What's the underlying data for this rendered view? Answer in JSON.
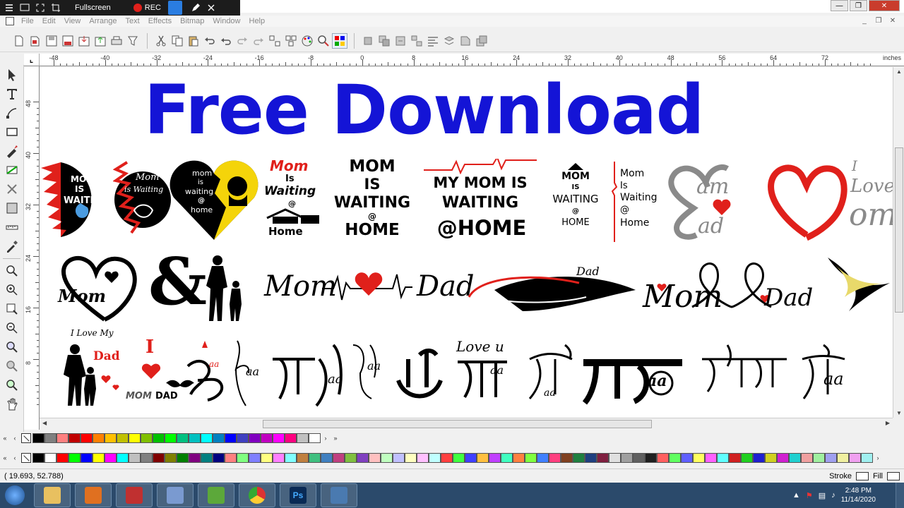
{
  "recorder": {
    "fullscreen_label": "Fullscreen",
    "rec_label": "REC"
  },
  "menu": [
    "File",
    "Edit",
    "View",
    "Arrange",
    "Text",
    "Effects",
    "Bitmap",
    "Window",
    "Help"
  ],
  "ruler": {
    "h_labels": [
      "-48",
      "-40",
      "-32",
      "-24",
      "-16",
      "-8",
      "0",
      "8",
      "16",
      "24",
      "32",
      "40",
      "48",
      "56",
      "64",
      "72"
    ],
    "v_labels": [
      "48",
      "40",
      "32",
      "24",
      "16",
      "8"
    ],
    "unit": "inches"
  },
  "canvas": {
    "headline": "Free Download",
    "row1": {
      "a1": "MOM",
      "a2": "IS",
      "a3": "WAITING",
      "b1": "Mom",
      "b2": "is Waiting",
      "c1": "mom",
      "c2": "is",
      "c3": "waiting",
      "c4": "@",
      "c5": "home",
      "d1": "Mom",
      "d2": "Is",
      "d3": "Waiting",
      "d4": "@",
      "d5": "Home",
      "e1": "MOM",
      "e2": "IS",
      "e3": "WAITING",
      "e4": "@",
      "e5": "HOME",
      "f1": "MY MOM IS",
      "f2": "WAITING",
      "f3": "@HOME",
      "g1": "MOM",
      "g2": "IS",
      "g3": "WAITING",
      "g4": "@",
      "g5": "HOME",
      "h1": "Mom",
      "h2": "Is",
      "h3": "Waiting",
      "h4": "@",
      "h5": "Home",
      "i1": "am",
      "i2": "ad",
      "j1": "I",
      "j2": "Love",
      "j3": "om"
    },
    "row2": {
      "k1": "Mom",
      "l1": "&",
      "m1": "Mom",
      "m2": "Dad",
      "n1": "Mom",
      "n2": "Dad",
      "o1": "Mom",
      "o2": "Dad"
    },
    "row3": {
      "p1": "I Love My",
      "p2": "Dad",
      "q1": "I",
      "q2": "MOM",
      "q3": "DAD",
      "r1": "aa",
      "s1": "aa",
      "t1": "aa",
      "u1": "aa",
      "v1": "Love u",
      "v2": "aa",
      "w1": "aa",
      "x1": "aa",
      "y1": "aa"
    }
  },
  "status": {
    "coords": "( 19.693,    52.788)",
    "stroke_label": "Stroke",
    "fill_label": "Fill"
  },
  "clock": {
    "time": "2:48 PM",
    "date": "11/14/2020"
  },
  "palette_colors_1": [
    "#000000",
    "#808080",
    "#ff8080",
    "#c00000",
    "#ff0000",
    "#ff8000",
    "#ffc000",
    "#c0c000",
    "#ffff00",
    "#80c000",
    "#00c000",
    "#00ff00",
    "#00c080",
    "#00c0c0",
    "#00ffff",
    "#0080c0",
    "#0000ff",
    "#4040c0",
    "#8000c0",
    "#c000c0",
    "#ff00ff",
    "#ff0080",
    "#c0c0c0",
    "#ffffff"
  ],
  "palette_colors_2": [
    "#000000",
    "#ffffff",
    "#ff0000",
    "#00ff00",
    "#0000ff",
    "#ffff00",
    "#ff00ff",
    "#00ffff",
    "#c0c0c0",
    "#808080",
    "#800000",
    "#808000",
    "#008000",
    "#800080",
    "#008080",
    "#000080",
    "#ff8080",
    "#80ff80",
    "#8080ff",
    "#ffff80",
    "#ff80ff",
    "#80ffff",
    "#c08040",
    "#40c080",
    "#4080c0",
    "#c04080",
    "#80c040",
    "#8040c0",
    "#ffc0c0",
    "#c0ffc0",
    "#c0c0ff",
    "#ffffc0",
    "#ffc0ff",
    "#c0ffff",
    "#ff4040",
    "#40ff40",
    "#4040ff",
    "#ffc040",
    "#c040ff",
    "#40ffc0",
    "#ff8040",
    "#80ff40",
    "#4080ff",
    "#ff4080",
    "#804020",
    "#208040",
    "#204080",
    "#802040",
    "#e0e0e0",
    "#a0a0a0",
    "#606060",
    "#202020",
    "#ff6060",
    "#60ff60",
    "#6060ff",
    "#ffff60",
    "#ff60ff",
    "#60ffff",
    "#d02020",
    "#20d020",
    "#2020d0",
    "#d0d020",
    "#d020d0",
    "#20d0d0",
    "#f0a0a0",
    "#a0f0a0",
    "#a0a0f0",
    "#f0f0a0",
    "#f0a0f0",
    "#a0f0f0"
  ],
  "colors": {
    "accent": "#1414d6",
    "red": "#e0201b",
    "taskbar": "#2b4a6b"
  }
}
